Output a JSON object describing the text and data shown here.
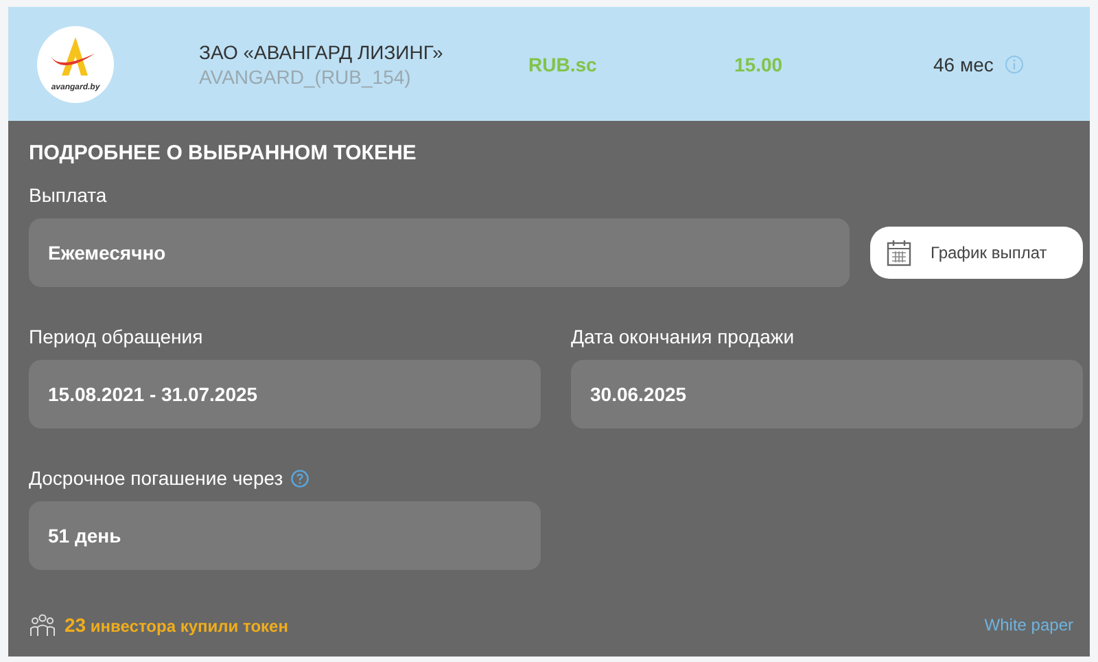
{
  "token": {
    "logo_text": "avangard.by",
    "issuer": "ЗАО «АВАНГАРД ЛИЗИНГ»",
    "code": "AVANGARD_(RUB_154)",
    "currency": "RUB.sc",
    "rate": "15.00",
    "term": "46 мес"
  },
  "details": {
    "title": "ПОДРОБНЕЕ О ВЫБРАННОМ ТОКЕНЕ",
    "fields": [
      {
        "label": "Выплата",
        "value": "Ежемесячно",
        "help": false
      },
      {
        "label": "Период обращения",
        "value": "15.08.2021 - 31.07.2025",
        "help": false
      },
      {
        "label": "Дата окончания продажи",
        "value": "30.06.2025",
        "help": false
      },
      {
        "label": "Досрочное погашение через",
        "value": "51 день",
        "help": true
      }
    ],
    "schedule_button": "График выплат",
    "investors": "**23** инвестора купили токен",
    "link": "White paper"
  }
}
